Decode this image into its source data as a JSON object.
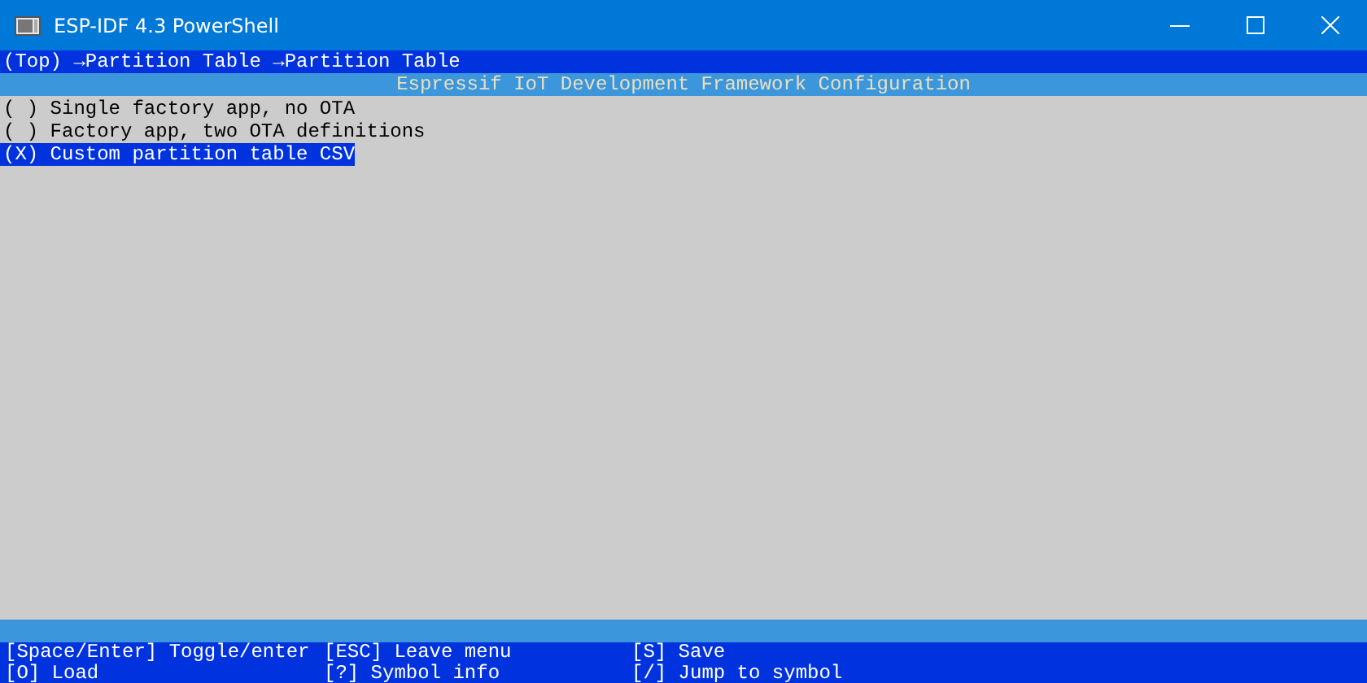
{
  "window": {
    "title": "ESP-IDF 4.3 PowerShell"
  },
  "breadcrumb": "(Top) →Partition Table →Partition Table",
  "header": "Espressif IoT Development Framework Configuration",
  "choices": [
    {
      "label": "( ) Single factory app, no OTA",
      "selected": false
    },
    {
      "label": "( ) Factory app, two OTA definitions",
      "selected": false
    },
    {
      "label": "(X) Custom partition table CSV",
      "selected": true
    }
  ],
  "keys": [
    [
      "[Space/Enter] Toggle/enter",
      "[ESC] Leave menu",
      "[S] Save"
    ],
    [
      "[O] Load",
      "[?] Symbol info",
      "[/] Jump to symbol"
    ]
  ]
}
